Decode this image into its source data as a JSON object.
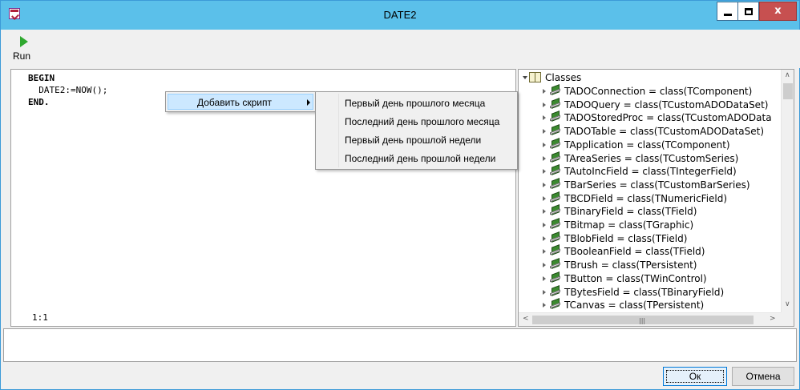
{
  "window": {
    "title": "DATE2",
    "controls": {
      "minimize": "_",
      "maximize": "□",
      "close": "x"
    }
  },
  "toolbar": {
    "run_label": "Run"
  },
  "editor": {
    "lines": [
      "BEGIN",
      "  DATE2:=NOW();",
      "END."
    ],
    "cursor_position": "1:1"
  },
  "context_menu": {
    "item_label": "Добавить скрипт",
    "submenu": [
      "Первый день прошлого месяца",
      "Последний день прошлого месяца",
      "Первый день прошлой недели",
      "Последний день прошлой недели"
    ]
  },
  "class_tree": {
    "root": "Classes",
    "items": [
      "TADOConnection = class(TComponent)",
      "TADOQuery = class(TCustomADODataSet)",
      "TADOStoredProc = class(TCustomADOData",
      "TADOTable = class(TCustomADODataSet)",
      "TApplication = class(TComponent)",
      "TAreaSeries = class(TCustomSeries)",
      "TAutoIncField = class(TIntegerField)",
      "TBarSeries = class(TCustomBarSeries)",
      "TBCDField = class(TNumericField)",
      "TBinaryField = class(TField)",
      "TBitmap = class(TGraphic)",
      "TBlobField = class(TField)",
      "TBooleanField = class(TField)",
      "TBrush = class(TPersistent)",
      "TButton = class(TWinControl)",
      "TBytesField = class(TBinaryField)",
      "TCanvas = class(TPersistent)"
    ]
  },
  "buttons": {
    "ok": "Ок",
    "cancel": "Отмена"
  },
  "colors": {
    "titlebar": "#5bc0ea",
    "close_button": "#c75050",
    "menu_highlight": "#cce8ff"
  }
}
